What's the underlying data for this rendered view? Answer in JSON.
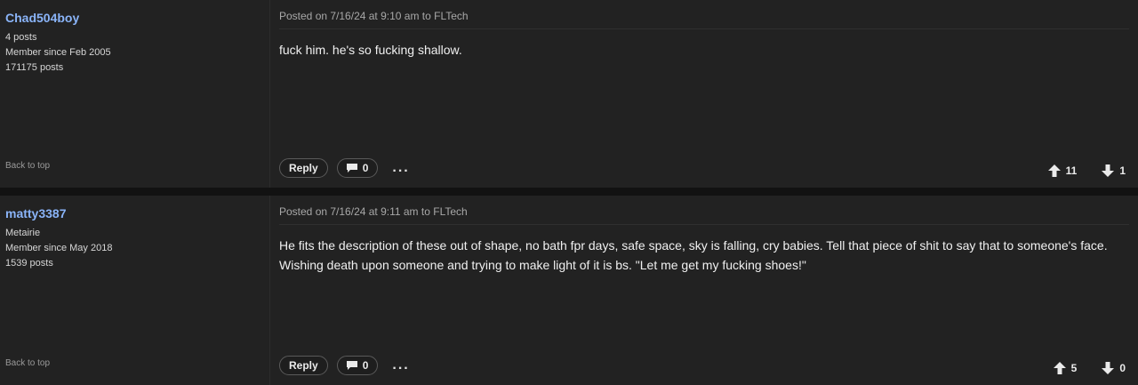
{
  "posts": [
    {
      "username": "Chad504boy",
      "meta": [
        "4 posts",
        "Member since Feb 2005",
        "171175 posts"
      ],
      "back_to_top": "Back to top",
      "posted": "Posted on 7/16/24 at 9:10 am to FLTech",
      "body": "fuck him. he's so fucking shallow.",
      "reply_label": "Reply",
      "comment_count": "0",
      "more_label": "...",
      "upvotes": "11",
      "downvotes": "1"
    },
    {
      "username": "matty3387",
      "meta": [
        "Metairie",
        "Member since May 2018",
        "1539 posts"
      ],
      "back_to_top": "Back to top",
      "posted": "Posted on 7/16/24 at 9:11 am to FLTech",
      "body": "He fits the description of these out of shape, no bath fpr days, safe space, sky is falling, cry babies. Tell that piece of shit to say that to someone's face. Wishing death upon someone and trying to make light of it is bs. \"Let me get my fucking shoes!\"",
      "reply_label": "Reply",
      "comment_count": "0",
      "more_label": "...",
      "upvotes": "5",
      "downvotes": "0"
    }
  ],
  "icons": {
    "comment": "comment-icon",
    "upvote": "arrow-up-icon",
    "downvote": "arrow-down-icon"
  },
  "colors": {
    "background": "#121212",
    "post_background": "#222222",
    "username": "#8ab4f8"
  }
}
